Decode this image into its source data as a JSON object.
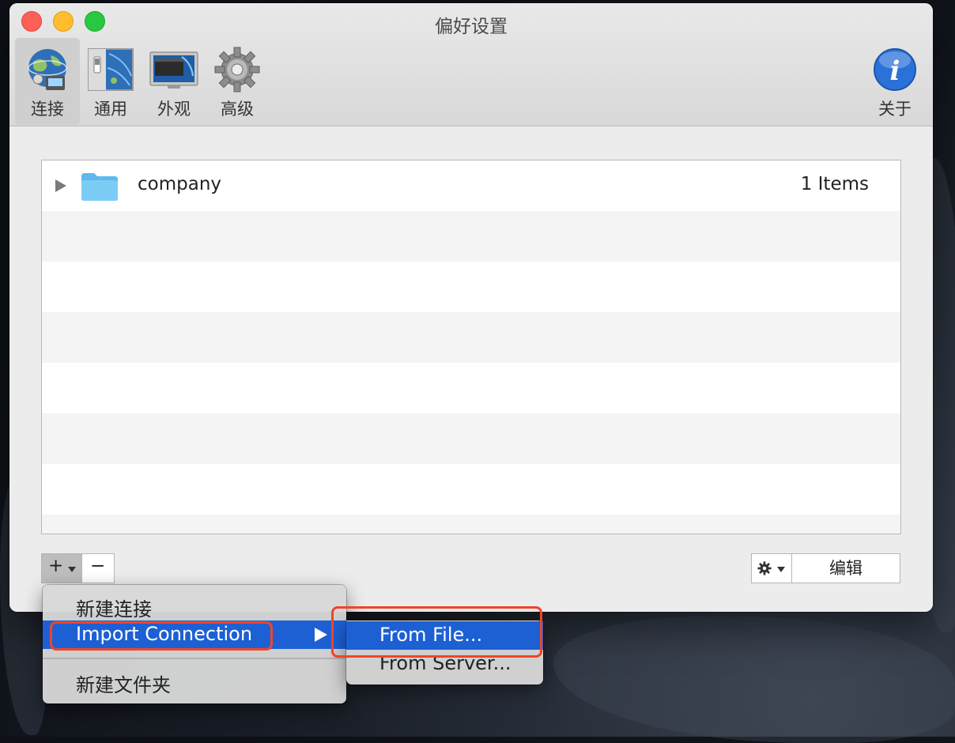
{
  "window": {
    "title": "偏好设置"
  },
  "toolbar": {
    "items": [
      {
        "label": "连接",
        "icon": "network-globe-icon",
        "active": true
      },
      {
        "label": "通用",
        "icon": "switch-panel-icon",
        "active": false
      },
      {
        "label": "外观",
        "icon": "display-monitor-icon",
        "active": false
      },
      {
        "label": "高级",
        "icon": "gear-icon",
        "active": false
      }
    ],
    "about": {
      "label": "关于",
      "icon": "info-icon"
    }
  },
  "list": {
    "rows": [
      {
        "name": "company",
        "count": "1 Items",
        "icon": "folder-icon"
      }
    ]
  },
  "bottom_bar": {
    "add_symbol": "+",
    "remove_symbol": "−",
    "edit_label": "编辑",
    "gear_icon": "gear-icon"
  },
  "context_menu": {
    "items": [
      {
        "label": "新建连接"
      },
      {
        "label": "Import Connection",
        "highlighted": true,
        "has_submenu": true
      },
      {
        "label": "新建文件夹"
      }
    ],
    "submenu": {
      "items": [
        {
          "label": "From File...",
          "highlighted": true
        },
        {
          "label": "From Server..."
        }
      ]
    }
  },
  "colors": {
    "highlight": "#1d60d4",
    "annotation": "#f0442a",
    "folder": "#6cc4f2"
  }
}
